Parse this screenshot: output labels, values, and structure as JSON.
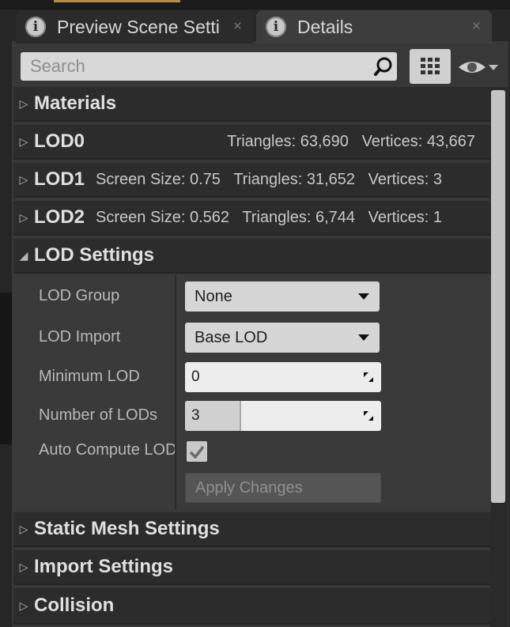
{
  "tabs": [
    {
      "label": "Preview Scene Setti",
      "icon": "info-icon",
      "close": "×"
    },
    {
      "label": "Details",
      "icon": "info-icon",
      "close": "×"
    }
  ],
  "search": {
    "placeholder": "Search",
    "value": ""
  },
  "sections": {
    "materials": {
      "title": "Materials"
    },
    "lod0": {
      "title": "LOD0",
      "info": "Triangles: 63,690   Vertices: 43,667"
    },
    "lod1": {
      "title": "LOD1",
      "info": "Screen Size: 0.75   Triangles: 31,652   Vertices: 3"
    },
    "lod2": {
      "title": "LOD2",
      "info": "Screen Size: 0.562   Triangles: 6,744   Vertices: 1"
    },
    "lod_settings": {
      "title": "LOD Settings"
    },
    "static_mesh": {
      "title": "Static Mesh Settings"
    },
    "import": {
      "title": "Import Settings"
    },
    "collision": {
      "title": "Collision"
    }
  },
  "lod_settings": {
    "lod_group": {
      "label": "LOD Group",
      "value": "None"
    },
    "lod_import": {
      "label": "LOD Import",
      "value": "Base LOD"
    },
    "minimum_lod": {
      "label": "Minimum LOD",
      "value": "0"
    },
    "number_of_lods": {
      "label": "Number of LODs",
      "value": "3",
      "slider_fraction": 0.28
    },
    "auto_compute": {
      "label": "Auto Compute LOD Distances",
      "checked": true
    },
    "apply": {
      "label": "Apply Changes"
    }
  },
  "colors": {
    "panel": "#383838",
    "header": "#2c2c2c",
    "field": "#d6d6d6",
    "accent": "#b88a3d"
  }
}
